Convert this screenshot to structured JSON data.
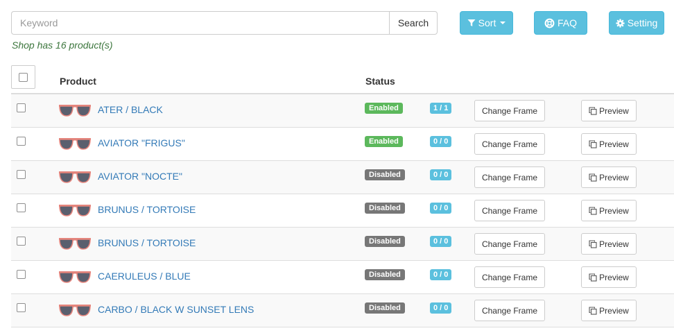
{
  "search": {
    "placeholder": "Keyword",
    "value": "",
    "button_label": "Search"
  },
  "toolbar": {
    "sort_label": "Sort",
    "faq_label": "FAQ",
    "setting_label": "Setting"
  },
  "summary": {
    "product_count_text": "Shop has 16 product(s)"
  },
  "table": {
    "headers": {
      "product": "Product",
      "status": "Status"
    },
    "rows": [
      {
        "name": "ATER / BLACK",
        "status": "Enabled",
        "frames": "1 / 1",
        "change_label": "Change Frame",
        "preview_label": "Preview"
      },
      {
        "name": "AVIATOR \"FRIGUS\"",
        "status": "Enabled",
        "frames": "0 / 0",
        "change_label": "Change Frame",
        "preview_label": "Preview"
      },
      {
        "name": "AVIATOR \"NOCTE\"",
        "status": "Disabled",
        "frames": "0 / 0",
        "change_label": "Change Frame",
        "preview_label": "Preview"
      },
      {
        "name": "BRUNUS / TORTOISE",
        "status": "Disabled",
        "frames": "0 / 0",
        "change_label": "Change Frame",
        "preview_label": "Preview"
      },
      {
        "name": "BRUNUS / TORTOISE",
        "status": "Disabled",
        "frames": "0 / 0",
        "change_label": "Change Frame",
        "preview_label": "Preview"
      },
      {
        "name": "CAERULEUS / BLUE",
        "status": "Disabled",
        "frames": "0 / 0",
        "change_label": "Change Frame",
        "preview_label": "Preview"
      },
      {
        "name": "CARBO / BLACK W SUNSET LENS",
        "status": "Disabled",
        "frames": "0 / 0",
        "change_label": "Change Frame",
        "preview_label": "Preview"
      }
    ]
  },
  "icons": {
    "sort": "filter-icon",
    "faq": "life-ring-icon",
    "setting": "gear-icon",
    "preview": "copy-icon",
    "thumbnail": "sunglasses-icon"
  },
  "colors": {
    "info": "#5bc0de",
    "success": "#5cb85c",
    "muted": "#777777",
    "link": "#337ab7",
    "count_text": "#3c763d"
  }
}
